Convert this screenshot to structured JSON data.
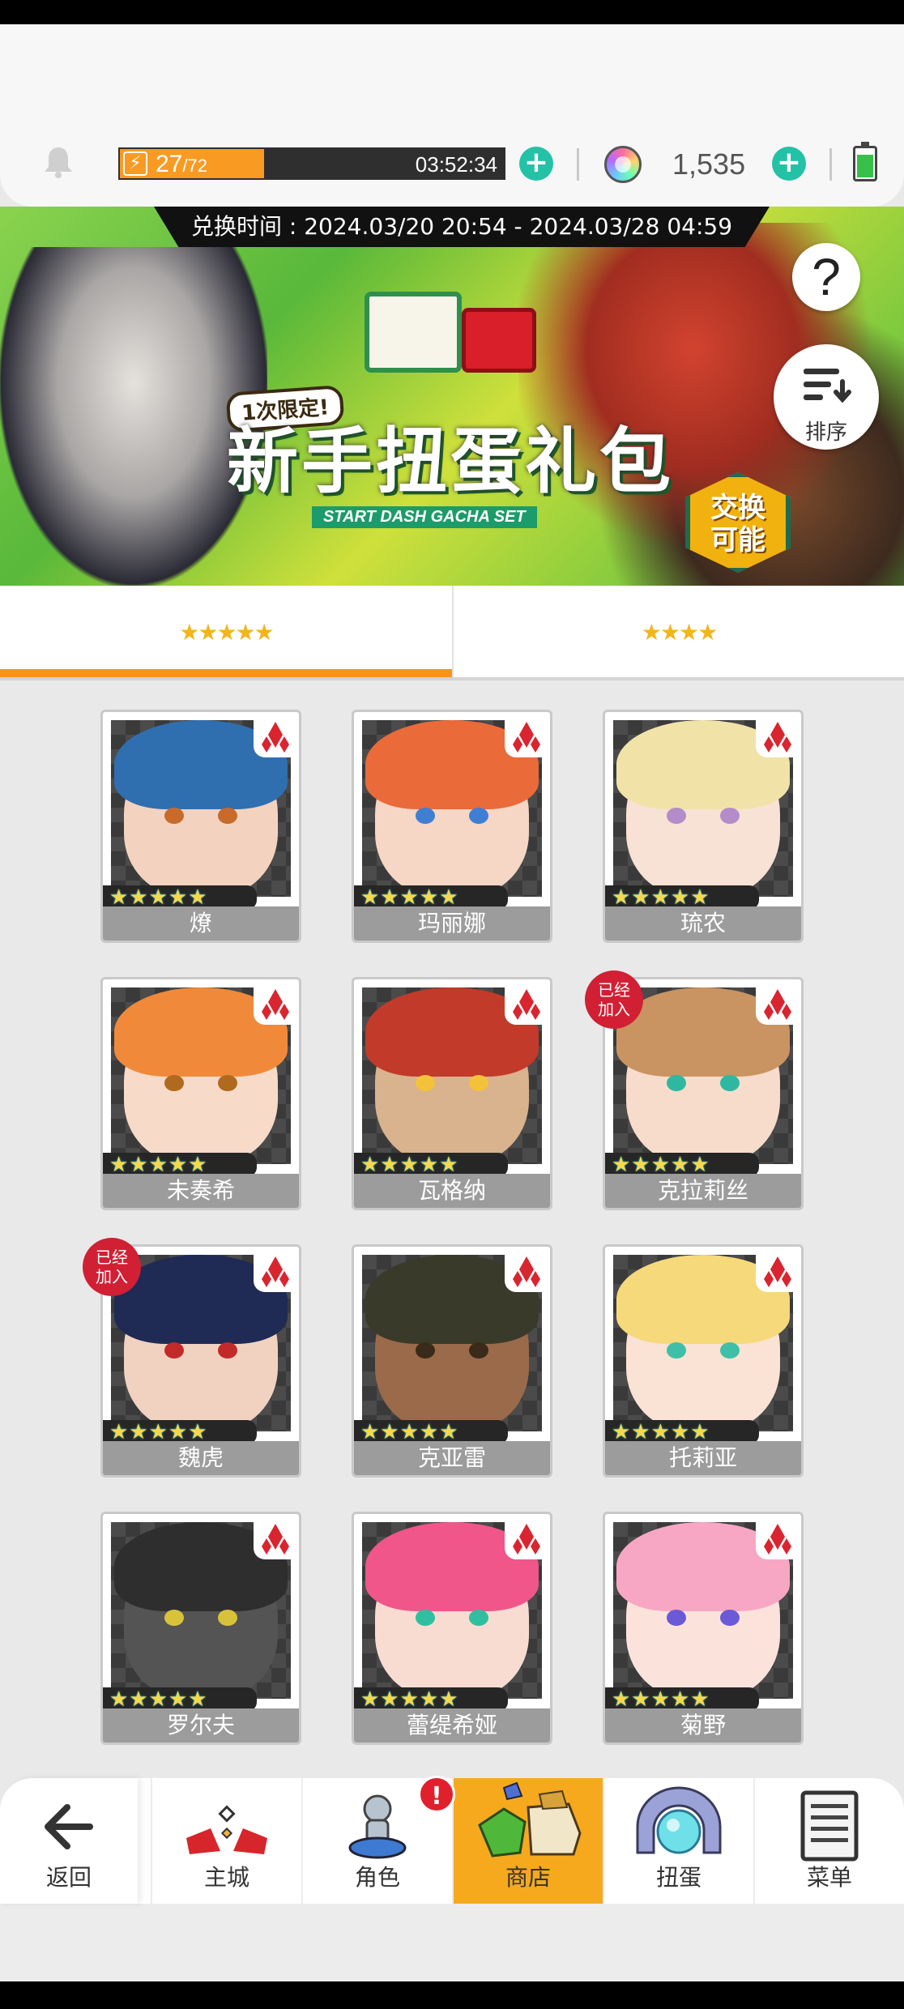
{
  "header": {
    "stamina_current": "27",
    "stamina_max": "/72",
    "stamina_fraction": 0.375,
    "stamina_timer": "03:52:34",
    "gem_count": "1,535",
    "icons": [
      "bell-icon",
      "lightning-icon",
      "gem-icon",
      "battery-icon"
    ]
  },
  "banner": {
    "exchange_period": "兑换时间 : 2024.03/20 20:54 - 2024.03/28 04:59",
    "limit_label": "1次限定!",
    "title": "新手扭蛋礼包",
    "subtitle": "START DASH GACHA SET",
    "exchange_badge_line1": "交换",
    "exchange_badge_line2": "可能",
    "help_label": "?",
    "sort_label": "排序"
  },
  "tabs": [
    {
      "label": "★★★★★",
      "active": true
    },
    {
      "label": "★★★★",
      "active": false
    }
  ],
  "characters": [
    {
      "name": "燎",
      "stars": "★★★★★",
      "joined": false,
      "hair": "#2f6fb0",
      "skin": "#f3d3c0",
      "eyes": "#c86a2a"
    },
    {
      "name": "玛丽娜",
      "stars": "★★★★★",
      "joined": false,
      "hair": "#ea6a3a",
      "skin": "#f6d6c5",
      "eyes": "#3f7fd1"
    },
    {
      "name": "琉农",
      "stars": "★★★★★",
      "joined": false,
      "hair": "#f1e3a8",
      "skin": "#f8e2d5",
      "eyes": "#b48cc9"
    },
    {
      "name": "未奏希",
      "stars": "★★★★★",
      "joined": false,
      "hair": "#f08a3a",
      "skin": "#f8dac9",
      "eyes": "#b06a1e"
    },
    {
      "name": "瓦格纳",
      "stars": "★★★★★",
      "joined": false,
      "hair": "#c23a2a",
      "skin": "#d9b28e",
      "eyes": "#f4c23a"
    },
    {
      "name": "克拉莉丝",
      "stars": "★★★★★",
      "joined": true,
      "hair": "#c99461",
      "skin": "#f8dccb",
      "eyes": "#2fb8a1"
    },
    {
      "name": "魏虎",
      "stars": "★★★★★",
      "joined": true,
      "hair": "#1f2a55",
      "skin": "#f1d2c1",
      "eyes": "#c22a2a"
    },
    {
      "name": "克亚雷",
      "stars": "★★★★★",
      "joined": false,
      "hair": "#3a3a2a",
      "skin": "#9a6a4a",
      "eyes": "#3a2a1a"
    },
    {
      "name": "托莉亚",
      "stars": "★★★★★",
      "joined": false,
      "hair": "#f6d97a",
      "skin": "#fae3d4",
      "eyes": "#3fbfa8"
    },
    {
      "name": "罗尔夫",
      "stars": "★★★★★",
      "joined": false,
      "hair": "#2e2e2e",
      "skin": "#545454",
      "eyes": "#d8c23a"
    },
    {
      "name": "蕾缇希娅",
      "stars": "★★★★★",
      "joined": false,
      "hair": "#f0568a",
      "skin": "#f8dcd2",
      "eyes": "#2fbfa0"
    },
    {
      "name": "菊野",
      "stars": "★★★★★",
      "joined": false,
      "hair": "#f7a7c4",
      "skin": "#fbe3dc",
      "eyes": "#6a5ad8"
    }
  ],
  "joined_label_line1": "已经",
  "joined_label_line2": "加入",
  "nav": {
    "back": "返回",
    "castle": "主城",
    "character": "角色",
    "shop": "商店",
    "gacha": "扭蛋",
    "menu": "菜单",
    "alert": "!"
  },
  "colors": {
    "accent_orange": "#f7941d",
    "stamina_orange": "#f99a22",
    "plus_teal": "#23c2a7",
    "joined_red": "#d11f34",
    "star_gold": "#f6d84c"
  }
}
